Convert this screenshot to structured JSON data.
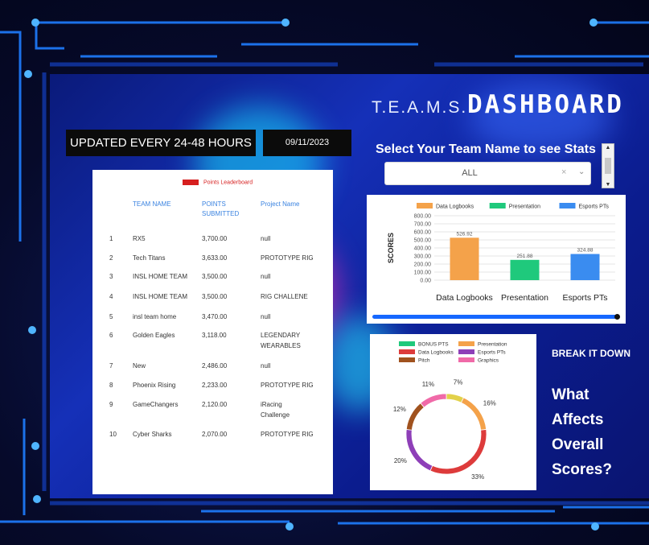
{
  "header": {
    "teams_text": "T.E.A.M.S.",
    "dashboard_text": "DASHBOARD"
  },
  "update_banner": {
    "label": "UPDATED EVERY 24-48 HOURS",
    "date": "09/11/2023"
  },
  "team_select": {
    "label": "Select Your Team Name to see Stats",
    "selected": "ALL",
    "clear_glyph": "×",
    "chevron_glyph": "⌄"
  },
  "leaderboard": {
    "legend": "Points Leaderboard",
    "legend_color": "#d61f1f",
    "columns": {
      "team": "TEAM NAME",
      "points_line1": "POINTS",
      "points_line2": "SUBMITTED",
      "project": "Project Name"
    },
    "rows": [
      {
        "rank": "1",
        "team": "RX5",
        "points": "3,700.00",
        "project": "null"
      },
      {
        "rank": "2",
        "team": "Tech Titans",
        "points": "3,633.00",
        "project": "PROTOTYPE RIG"
      },
      {
        "rank": "3",
        "team": "INSL HOME TEAM",
        "points": "3,500.00",
        "project": "null"
      },
      {
        "rank": "4",
        "team": "INSL HOME TEAM",
        "points": "3,500.00",
        "project": "RIG CHALLENE"
      },
      {
        "rank": "5",
        "team": "insl team home",
        "points": "3,470.00",
        "project": "null"
      },
      {
        "rank": "6",
        "team": "Golden Eagles",
        "points": "3,118.00",
        "project": "LEGENDARY",
        "project2": "WEARABLES"
      },
      {
        "rank": "7",
        "team": "New",
        "points": "2,486.00",
        "project": "null"
      },
      {
        "rank": "8",
        "team": "Phoenix Rising",
        "points": "2,233.00",
        "project": "PROTOTYPE RIG"
      },
      {
        "rank": "9",
        "team": "GameChangers",
        "points": "2,120.00",
        "project": "iRacing",
        "project2": "Challenge"
      },
      {
        "rank": "10",
        "team": "Cyber Sharks",
        "points": "2,070.00",
        "project": "PROTOTYPE RIG"
      }
    ]
  },
  "break_it_down": {
    "label": "BREAK IT DOWN",
    "line1": "What",
    "line2": "Affects",
    "line3": "Overall",
    "line4": "Scores?"
  },
  "chart_data": [
    {
      "type": "bar",
      "ylabel": "SCORES",
      "categories": [
        "Data Logbooks",
        "Presentation",
        "Esports PTs"
      ],
      "series": [
        {
          "name": "Data Logbooks",
          "color": "#f4a24a",
          "values": [
            526.92,
            null,
            null
          ]
        },
        {
          "name": "Presentation",
          "color": "#1fc97c",
          "values": [
            null,
            251.88,
            null
          ]
        },
        {
          "name": "Esports PTs",
          "color": "#3a8cf0",
          "values": [
            null,
            null,
            324.88
          ]
        }
      ],
      "value_labels": [
        "526.92",
        "251.88",
        "324.88"
      ],
      "ylim": [
        0,
        800
      ],
      "yticks": [
        "0.00",
        "100.00",
        "200.00",
        "300.00",
        "400.00",
        "500.00",
        "600.00",
        "700.00",
        "800.00"
      ],
      "legend": "top"
    },
    {
      "type": "pie",
      "style": "donut",
      "legend": "top",
      "slices": [
        {
          "name": "BONUS PTS",
          "color": "#1fc97c",
          "value": 0
        },
        {
          "name": "Presentation",
          "color": "#f4a24a",
          "value": 16,
          "label": "16%"
        },
        {
          "name": "Data Logbooks",
          "color": "#dd3b3b",
          "value": 33,
          "label": "33%"
        },
        {
          "name": "Esports PTs",
          "color": "#8e3fb8",
          "value": 20,
          "label": "20%"
        },
        {
          "name": "Pitch",
          "color": "#a0521e",
          "value": 12,
          "label": "12%"
        },
        {
          "name": "Graphics",
          "color": "#f06aa8",
          "value": 11,
          "label": "11%"
        },
        {
          "name": "",
          "color": "#e2d14a",
          "value": 7,
          "label": "7%"
        }
      ]
    }
  ]
}
